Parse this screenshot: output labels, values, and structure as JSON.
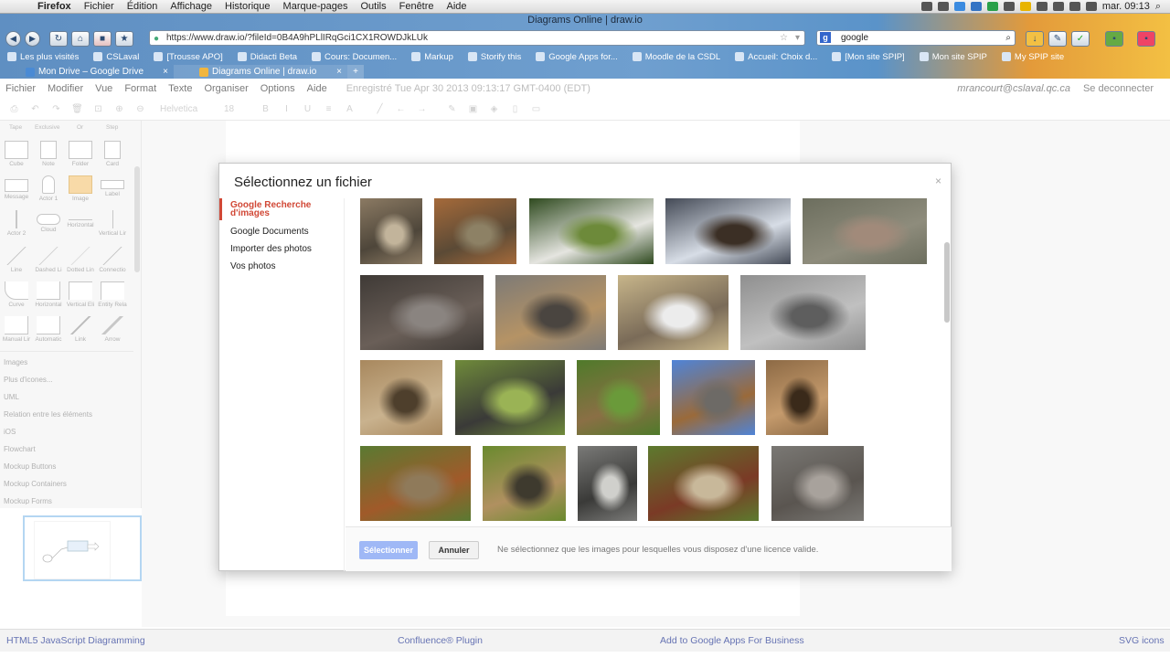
{
  "mac_menubar": {
    "app": "Firefox",
    "menus": [
      "Fichier",
      "Édition",
      "Affichage",
      "Historique",
      "Marque-pages",
      "Outils",
      "Fenêtre",
      "Aide"
    ],
    "clock": "mar. 09:13"
  },
  "browser": {
    "window_title": "Diagrams Online | draw.io",
    "url": "https://www.draw.io/?fileId=0B4A9hPLlIRqGci1CX1ROWDJkLUk",
    "search_engine": "google",
    "search_value": "google",
    "bookmarks": [
      "Les plus visités",
      "CSLaval",
      "[Trousse APO]",
      "Didacti Beta",
      "Cours: Documen...",
      "Markup",
      "Storify this",
      "Google Apps for...",
      "Moodle de la CSDL",
      "Accueil: Choix d...",
      "[Mon site SPIP]",
      "Mon site SPIP",
      "My SPIP site"
    ],
    "tabs": [
      {
        "label": "Mon Drive – Google Drive",
        "active": false
      },
      {
        "label": "Diagrams Online | draw.io",
        "active": true
      }
    ],
    "new_tab_label": "+"
  },
  "app": {
    "menu": [
      "Fichier",
      "Modifier",
      "Vue",
      "Format",
      "Texte",
      "Organiser",
      "Options",
      "Aide"
    ],
    "saved_status": "Enregistré Tue Apr 30 2013 09:13:17 GMT-0400 (EDT)",
    "user": "mrancourt@cslaval.qc.ca",
    "logout": "Se deconnecter",
    "font_name": "Helvetica",
    "font_size": "18"
  },
  "sidebar": {
    "top_labels": [
      "Tape",
      "Exclusive",
      "Or",
      "Step"
    ],
    "shapes": [
      "Cube",
      "Note",
      "Folder",
      "Card",
      "Message",
      "Actor 1",
      "Image",
      "Label",
      "Actor 2",
      "Cloud",
      "Horizontal",
      "Vertical Lir",
      "Line",
      "Dashed Li",
      "Dotted Lin",
      "Connectio",
      "Curve",
      "Horizontal",
      "Vertical Eli",
      "Entity Rela",
      "Manual Lir",
      "Automatic",
      "Link",
      "Arrow"
    ],
    "palettes": [
      "Images",
      "Plus d'icones...",
      "UML",
      "Relation entre les éléments",
      "iOS",
      "Flowchart",
      "Mockup Buttons",
      "Mockup Containers",
      "Mockup Forms"
    ]
  },
  "dialog": {
    "title": "Sélectionnez un fichier",
    "close": "×",
    "nav": [
      "Google Recherche d'images",
      "Google Documents",
      "Importer des photos",
      "Vos photos"
    ],
    "thumbnails": [
      {
        "subject": "chipmunk",
        "colors": [
          "#8b7a63",
          "#4e463a",
          "#c2b49b"
        ]
      },
      {
        "subject": "red-squirrel",
        "colors": [
          "#a56a3a",
          "#5b4a36",
          "#8d8165"
        ]
      },
      {
        "subject": "skunk",
        "colors": [
          "#2f4a1f",
          "#e5e5e0",
          "#6d8a3a"
        ]
      },
      {
        "subject": "elk-in-snow",
        "colors": [
          "#444a56",
          "#d7dde6",
          "#3b2f25"
        ]
      },
      {
        "subject": "deer",
        "colors": [
          "#6c6e5e",
          "#8e8c7c",
          "#a18a7a"
        ]
      },
      {
        "subject": "seal-on-rock",
        "colors": [
          "#3f3a36",
          "#6a5f58",
          "#8a8480"
        ]
      },
      {
        "subject": "chipmunk",
        "colors": [
          "#7d7a76",
          "#b59365",
          "#4a4540"
        ]
      },
      {
        "subject": "chipmunk-on-bowl",
        "colors": [
          "#c7b58a",
          "#7a6b58",
          "#ececec"
        ]
      },
      {
        "subject": "rock",
        "colors": [
          "#8f8f8f",
          "#c0c0c0",
          "#5e5e5e"
        ]
      },
      {
        "subject": "squirrel",
        "colors": [
          "#a8885e",
          "#c9b28e",
          "#4e3f2c"
        ]
      },
      {
        "subject": "animal-in-grass",
        "colors": [
          "#6f8a3a",
          "#3a3a38",
          "#9ab355"
        ]
      },
      {
        "subject": "chipmunk-in-grass",
        "colors": [
          "#4f7a2a",
          "#8a6f45",
          "#6a9a3a"
        ]
      },
      {
        "subject": "squirrel-blue-sky",
        "colors": [
          "#4f84d8",
          "#9a6a3a",
          "#6d6a66"
        ]
      },
      {
        "subject": "bat",
        "colors": [
          "#8d6a45",
          "#c49a6c",
          "#3a2a1a"
        ]
      },
      {
        "subject": "chipmunk-with-leaves",
        "colors": [
          "#5a7a32",
          "#a05a2a",
          "#8f7a5a"
        ]
      },
      {
        "subject": "chipmunk",
        "colors": [
          "#6a8a2e",
          "#b09060",
          "#3e3a2e"
        ]
      },
      {
        "subject": "raccoon",
        "colors": [
          "#7a7a78",
          "#3a3a38",
          "#d0d0cc"
        ]
      },
      {
        "subject": "chipmunk-in-hand",
        "colors": [
          "#5d7a2e",
          "#7a3a26",
          "#c8b89a"
        ]
      },
      {
        "subject": "chipmunk-on-rock",
        "colors": [
          "#7a7874",
          "#5a5550",
          "#a8a29c"
        ]
      }
    ],
    "select_button": "Sélectionner",
    "cancel_button": "Annuler",
    "notice": "Ne sélectionnez que les images pour lesquelles vous disposez d'une licence valide."
  },
  "footer": {
    "links": [
      "HTML5 JavaScript Diagramming",
      "Confluence® Plugin",
      "Add to Google Apps For Business",
      "SVG icons"
    ]
  }
}
